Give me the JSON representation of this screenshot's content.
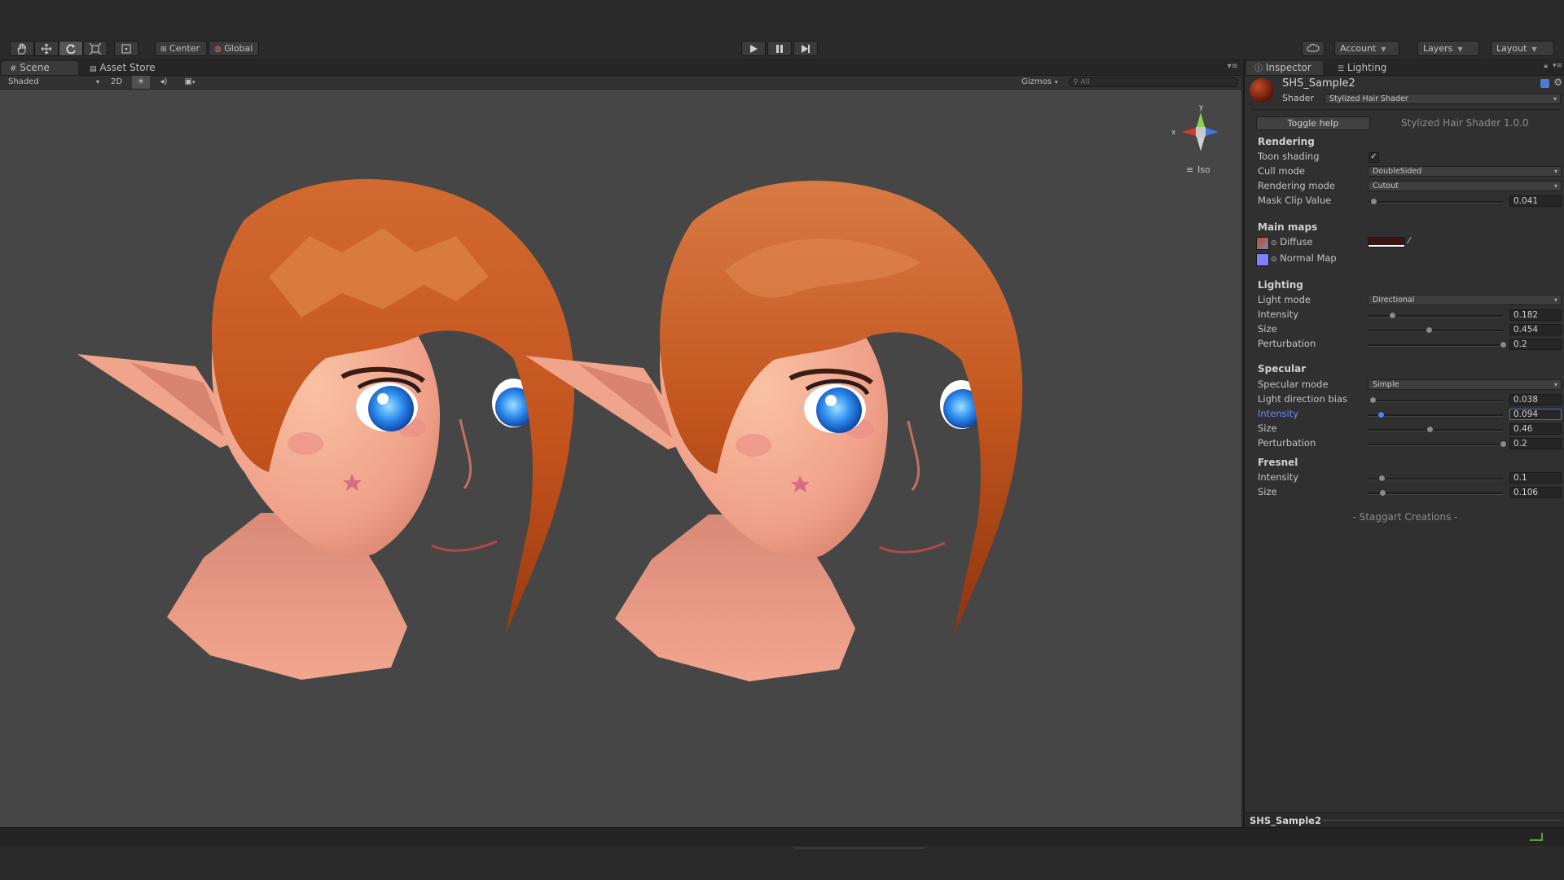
{
  "toolbar": {
    "pivot_label": "Center",
    "space_label": "Global",
    "account_label": "Account",
    "layers_label": "Layers",
    "layout_label": "Layout"
  },
  "scene": {
    "tabs": [
      "Scene",
      "Asset Store"
    ],
    "draw_mode": "Shaded",
    "mode_2d": "2D",
    "gizmos_label": "Gizmos",
    "search_placeholder": "All",
    "gizmo_axes": {
      "x": "x",
      "y": "y"
    },
    "projection": "Iso"
  },
  "inspector": {
    "tabs": [
      "Inspector",
      "Lighting"
    ],
    "object_name": "SHS_Sample2",
    "shader_label": "Shader",
    "shader_value": "Stylized Hair Shader",
    "toggle_help": "Toggle help",
    "version": "Stylized Hair Shader 1.0.0",
    "credit": "- Staggart Creations -",
    "sections": {
      "rendering": {
        "title": "Rendering",
        "toon_shading": {
          "label": "Toon shading",
          "checked": true
        },
        "cull_mode": {
          "label": "Cull mode",
          "value": "DoubleSided"
        },
        "rendering_mode": {
          "label": "Rendering mode",
          "value": "Cutout"
        },
        "mask_clip": {
          "label": "Mask Clip Value",
          "value": "0.041",
          "fraction": 0.041
        }
      },
      "main_maps": {
        "title": "Main maps",
        "diffuse": {
          "label": "Diffuse",
          "color": "#3a1410"
        },
        "normal_map": {
          "label": "Normal Map",
          "color": "#7f7fff"
        }
      },
      "lighting": {
        "title": "Lighting",
        "light_mode": {
          "label": "Light mode",
          "value": "Directional"
        },
        "intensity": {
          "label": "Intensity",
          "value": "0.182",
          "fraction": 0.182
        },
        "size": {
          "label": "Size",
          "value": "0.454",
          "fraction": 0.454
        },
        "perturbation": {
          "label": "Perturbation",
          "value": "0.2",
          "fraction": 1.0
        }
      },
      "specular": {
        "title": "Specular",
        "specular_mode": {
          "label": "Specular mode",
          "value": "Simple"
        },
        "light_direction_bias": {
          "label": "Light direction bias",
          "value": "0.038",
          "fraction": 0.038
        },
        "intensity": {
          "label": "Intensity",
          "value": "0.094",
          "fraction": 0.094
        },
        "size": {
          "label": "Size",
          "value": "0.46",
          "fraction": 0.46
        },
        "perturbation": {
          "label": "Perturbation",
          "value": "0.2",
          "fraction": 1.0
        }
      },
      "fresnel": {
        "title": "Fresnel",
        "intensity": {
          "label": "Intensity",
          "value": "0.1",
          "fraction": 0.1
        },
        "size": {
          "label": "Size",
          "value": "0.106",
          "fraction": 0.106
        }
      }
    },
    "preview_title": "SHS_Sample2"
  },
  "colors": {
    "accent_blue": "#5a7ff0",
    "hair": "#c0501a",
    "skin": "#f0a88a"
  }
}
